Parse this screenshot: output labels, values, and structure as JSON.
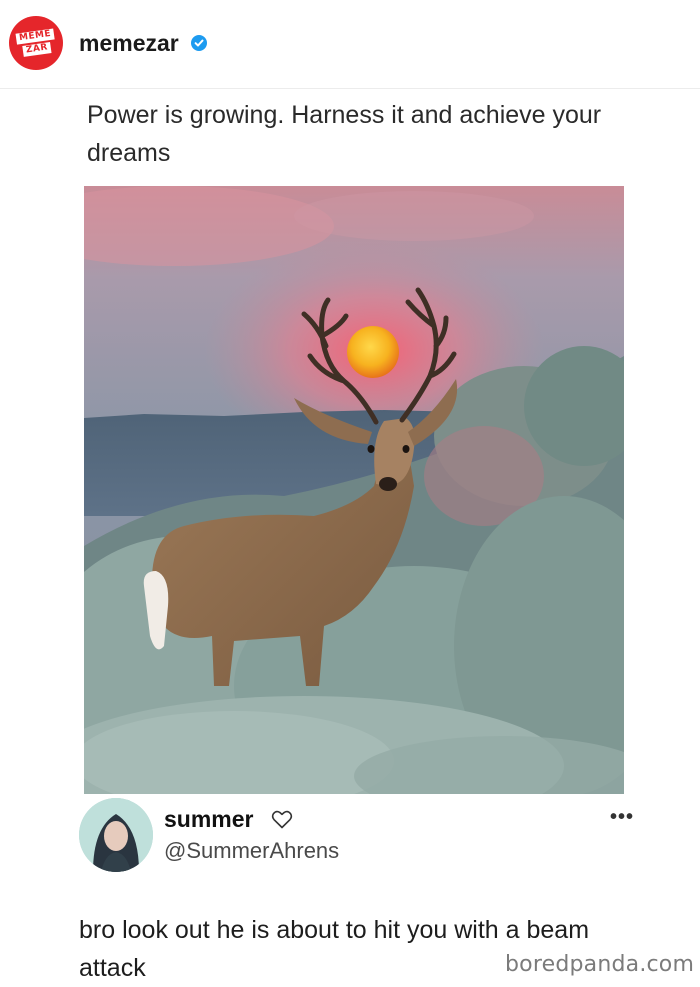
{
  "post": {
    "account": {
      "name": "memezar",
      "logo_text": [
        "MEME",
        "ZAR"
      ],
      "verified": true,
      "brand_color": "#e5262b",
      "verified_color": "#1d9bf0"
    },
    "caption": "Power is growing. Harness it and achieve your dreams",
    "image": {
      "icon": "deer-sunset-photo"
    }
  },
  "reply": {
    "name": "summer",
    "handle": "@SummerAhrens",
    "text": "bro look out he is about to hit you with a beam attack",
    "icons": [
      "heart-outline-icon",
      "more-options-icon"
    ],
    "more_label": "•••"
  },
  "watermark": "boredpanda.com"
}
